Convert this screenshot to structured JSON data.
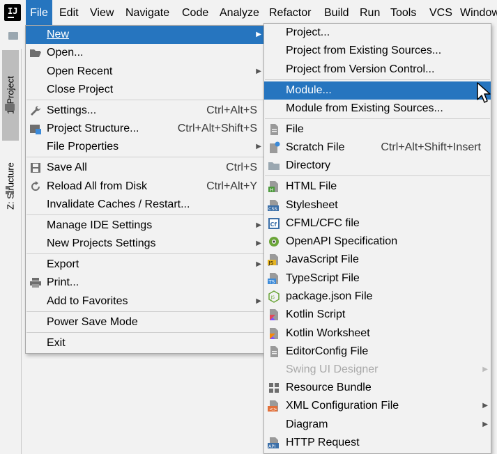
{
  "menubar": {
    "items": [
      "File",
      "Edit",
      "View",
      "Navigate",
      "Code",
      "Analyze",
      "Refactor",
      "Build",
      "Run",
      "Tools",
      "VCS",
      "Window"
    ]
  },
  "tool_windows": {
    "project_tab": "1: Project",
    "structure_tab": "Z: Structure"
  },
  "file_menu": {
    "new": "New",
    "open": "Open...",
    "open_recent": "Open Recent",
    "close_project": "Close Project",
    "settings": "Settings...",
    "settings_shortcut": "Ctrl+Alt+S",
    "project_structure": "Project Structure...",
    "project_structure_shortcut": "Ctrl+Alt+Shift+S",
    "file_properties": "File Properties",
    "save_all": "Save All",
    "save_all_shortcut": "Ctrl+S",
    "reload_all": "Reload All from Disk",
    "reload_all_shortcut": "Ctrl+Alt+Y",
    "invalidate_caches": "Invalidate Caches / Restart...",
    "manage_ide_settings": "Manage IDE Settings",
    "new_projects_settings": "New Projects Settings",
    "export": "Export",
    "print": "Print...",
    "add_to_favorites": "Add to Favorites",
    "power_save_mode": "Power Save Mode",
    "exit": "Exit"
  },
  "new_menu": {
    "project": "Project...",
    "project_from_existing": "Project from Existing Sources...",
    "project_from_vcs": "Project from Version Control...",
    "module": "Module...",
    "module_from_existing": "Module from Existing Sources...",
    "file": "File",
    "scratch_file": "Scratch File",
    "scratch_file_shortcut": "Ctrl+Alt+Shift+Insert",
    "directory": "Directory",
    "html_file": "HTML File",
    "stylesheet": "Stylesheet",
    "cfml_file": "CFML/CFC file",
    "openapi_spec": "OpenAPI Specification",
    "javascript_file": "JavaScript File",
    "typescript_file": "TypeScript File",
    "package_json": "package.json File",
    "kotlin_script": "Kotlin Script",
    "kotlin_worksheet": "Kotlin Worksheet",
    "editorconfig_file": "EditorConfig File",
    "swing_ui_designer": "Swing UI Designer",
    "resource_bundle": "Resource Bundle",
    "xml_config_file": "XML Configuration File",
    "diagram": "Diagram",
    "http_request": "HTTP Request"
  },
  "icon_text": {
    "logo": "IJ",
    "html": "H",
    "css": "CSS",
    "cfml": "Cf",
    "js": "JS",
    "ts": "TS",
    "package_json": "JS",
    "xml": "<>",
    "api": "API"
  },
  "colors": {
    "selection": "#2675bf",
    "menu_bg": "#f2f2f2"
  }
}
